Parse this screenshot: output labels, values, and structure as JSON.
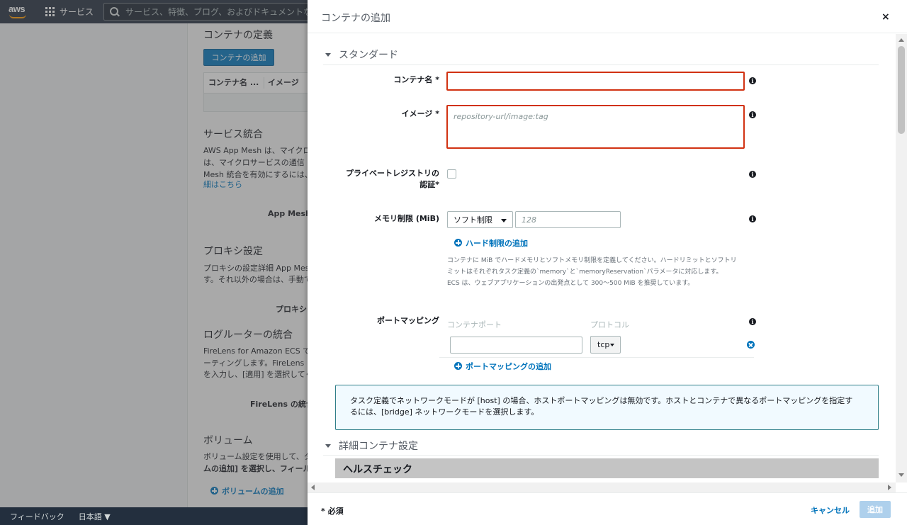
{
  "topnav": {
    "logo": "aws",
    "services_label": "サービス",
    "search_placeholder": "サービス、特徴、ブログ、およびドキュメントなどを検"
  },
  "background": {
    "container_def_title": "コンテナの定義",
    "add_container_btn": "コンテナの追加",
    "table_headers": [
      "コンテナ名 ...",
      "イメージ"
    ],
    "service_integration_title": "サービス統合",
    "service_integration_text": [
      "AWS App Mesh は、マイクロ",
      "は、マイクロサービスの通信",
      "Mesh 統合を有効にするには、"
    ],
    "service_integration_link": "細はこちら",
    "app_mesh_label": "App Mesh",
    "proxy_title": "プロキシ設定",
    "proxy_text": [
      "プロキシの設定詳細 App Mesh",
      "す。それ以外の場合は、手動で"
    ],
    "proxy_label": "プロキシ",
    "log_router_title": "ログルーターの統合",
    "log_router_text": [
      "FireLens for Amazon ECS では",
      "ーティングします。FireLens",
      "を入力し、[適用] を選択してく"
    ],
    "firelens_label": "FireLens の統合",
    "volume_title": "ボリューム",
    "volume_text": [
      "ボリューム設定を使用して、タ",
      "ムの追加] を選択し、フィール"
    ],
    "volume_add": "ボリュームの追加"
  },
  "footer": {
    "feedback": "フィードバック",
    "language": "日本語 ▼"
  },
  "panel": {
    "title": "コンテナの追加",
    "close": "×",
    "standard_section": "スタンダード",
    "container_name_label": "コンテナ名 *",
    "container_name_value": "",
    "image_label": "イメージ *",
    "image_placeholder": "repository-url/image:tag",
    "private_registry_label_1": "プライベートレジストリの",
    "private_registry_label_2": "認証*",
    "memory_label": "メモリ制限 (MiB)",
    "memory_select": "ソフト制限",
    "memory_placeholder": "128",
    "add_hard_limit": "ハード制限の追加",
    "memory_help": [
      "コンテナに MiB でハードメモリとソフトメモリ制限を定義してください。ハードリミットとソフトリ",
      "ミットはそれぞれタスク定義の`memory`と`memoryReservation`パラメータに対応します。",
      "ECS は、ウェブアプリケーションの出発点として 300～500 MiB を推奨しています。"
    ],
    "port_mapping_label": "ポートマッピング",
    "container_port_header": "コンテナポート",
    "protocol_header": "プロトコル",
    "container_port_value": "",
    "protocol_value": "tcp",
    "add_port_mapping": "ポートマッピングの追加",
    "alert_text": "タスク定義でネットワークモードが [host] の場合、ホストポートマッピングは無効です。ホストとコンテナで異なるポートマッピングを指定するには、[bridge] ネットワークモードを選択します。",
    "advanced_section": "詳細コンテナ設定",
    "healthcheck_title": "ヘルスチェック",
    "info_glyph": "i",
    "required_note": "* 必須",
    "cancel": "キャンセル",
    "add": "追加"
  },
  "colors": {
    "nav_bg": "#232f3e",
    "primary": "#0073bb",
    "error_border": "#d13212",
    "disabled_add": "#aed0ec"
  }
}
